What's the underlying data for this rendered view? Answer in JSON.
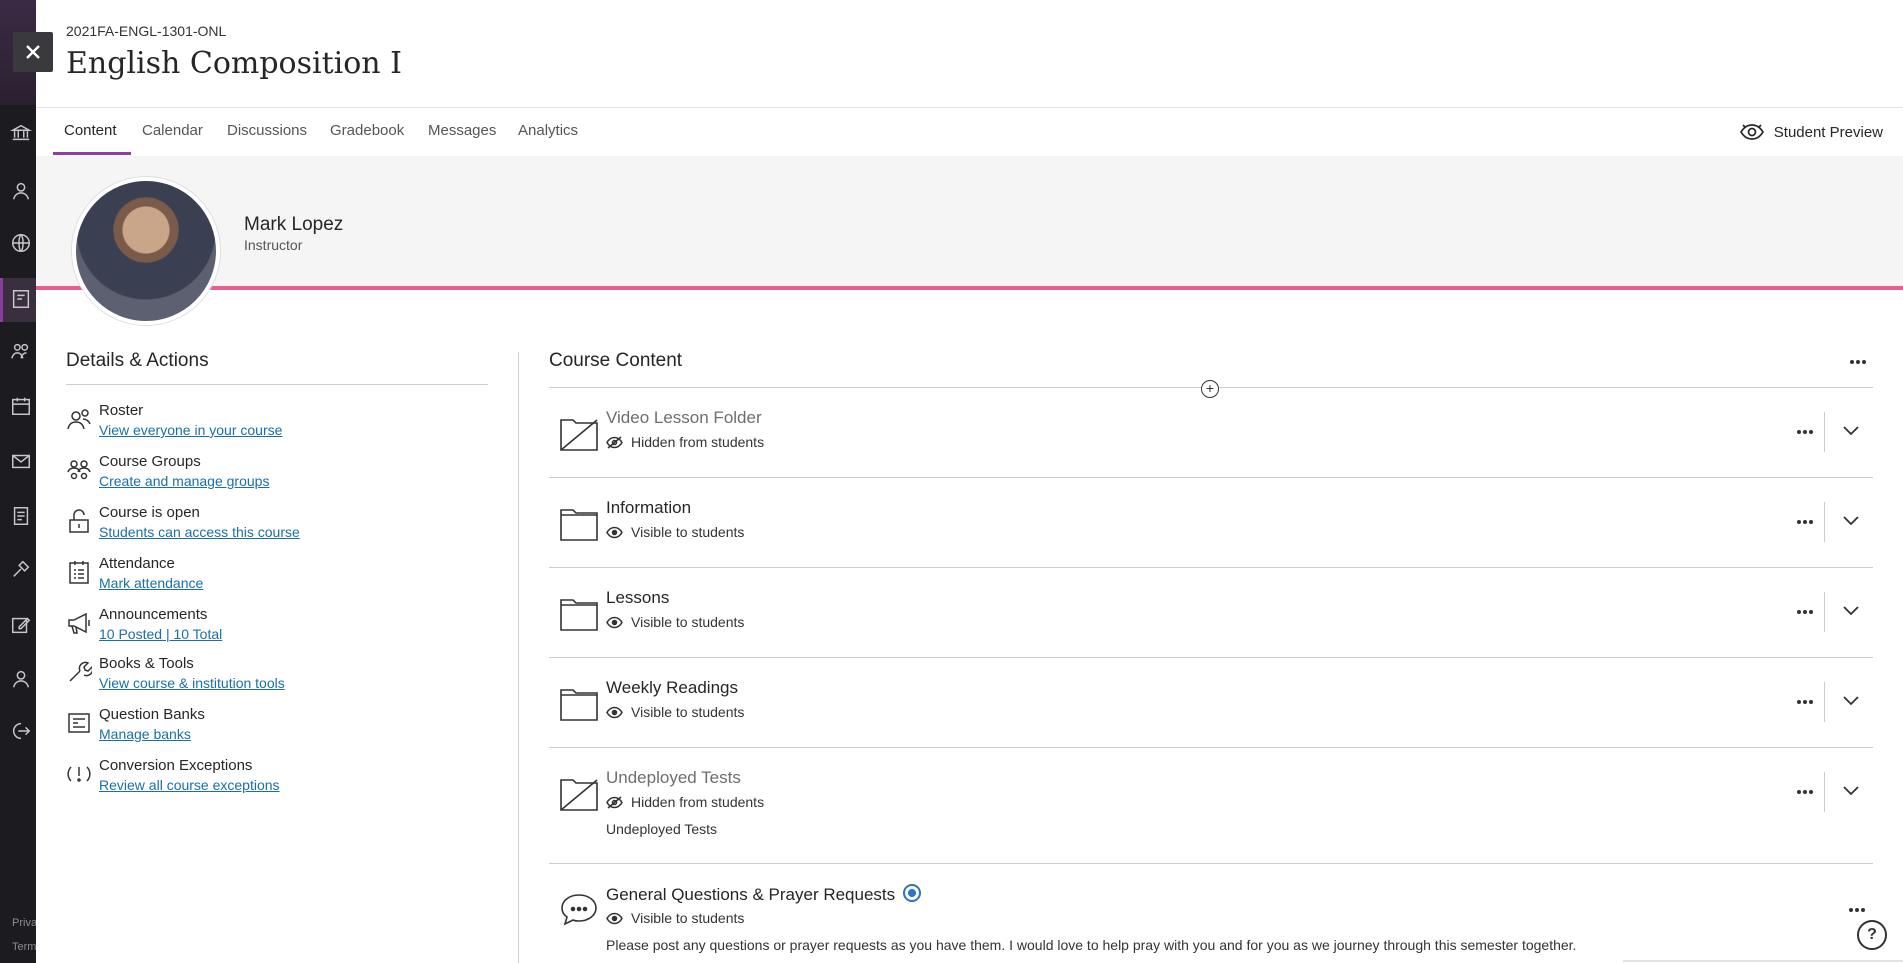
{
  "course": {
    "code": "2021FA-ENGL-1301-ONL",
    "title": "English Composition I"
  },
  "tabs": [
    {
      "label": "Content",
      "active": true
    },
    {
      "label": "Calendar"
    },
    {
      "label": "Discussions"
    },
    {
      "label": "Gradebook"
    },
    {
      "label": "Messages"
    },
    {
      "label": "Analytics"
    }
  ],
  "student_preview_label": "Student Preview",
  "instructor": {
    "name": "Mark Lopez",
    "role": "Instructor"
  },
  "details": {
    "heading": "Details & Actions",
    "items": [
      {
        "icon": "roster-icon",
        "title": "Roster",
        "link": "View everyone in your course"
      },
      {
        "icon": "groups-icon",
        "title": "Course Groups",
        "link": "Create and manage groups"
      },
      {
        "icon": "unlock-icon",
        "title": "Course is open",
        "link": "Students can access this course"
      },
      {
        "icon": "attendance-icon",
        "title": "Attendance",
        "link": "Mark attendance"
      },
      {
        "icon": "megaphone-icon",
        "title": "Announcements",
        "link": "10 Posted | 10 Total"
      },
      {
        "icon": "wrench-icon",
        "title": "Books & Tools",
        "link": "View course & institution tools"
      },
      {
        "icon": "question-bank-icon",
        "title": "Question Banks",
        "link": "Manage banks"
      },
      {
        "icon": "conversion-exception-icon",
        "title": "Conversion Exceptions",
        "link": "Review all course exceptions"
      }
    ]
  },
  "content": {
    "heading": "Course Content",
    "items": [
      {
        "icon": "hidden-folder-icon",
        "title": "Video Lesson Folder",
        "visibility": "Hidden from students",
        "hidden": true
      },
      {
        "icon": "folder-icon",
        "title": "Information",
        "visibility": "Visible to students"
      },
      {
        "icon": "folder-icon",
        "title": "Lessons",
        "visibility": "Visible to students"
      },
      {
        "icon": "folder-icon",
        "title": "Weekly Readings",
        "visibility": "Visible to students"
      },
      {
        "icon": "hidden-folder-icon",
        "title": "Undeployed Tests",
        "visibility": "Hidden from students",
        "hidden": true,
        "description": "Undeployed Tests"
      },
      {
        "icon": "discussion-icon",
        "title": "General Questions & Prayer Requests",
        "visibility": "Visible to students",
        "description": "Please post any questions or prayer requests as you have them. I would love to help pray with you and for you as we journey through this semester together."
      }
    ]
  },
  "footer": {
    "privacy": "Priva",
    "terms": "Term"
  },
  "help_label": "?",
  "colors": {
    "accent": "#8f3ea6",
    "banner_line": "#e8608a",
    "link": "#1a6fa8"
  }
}
